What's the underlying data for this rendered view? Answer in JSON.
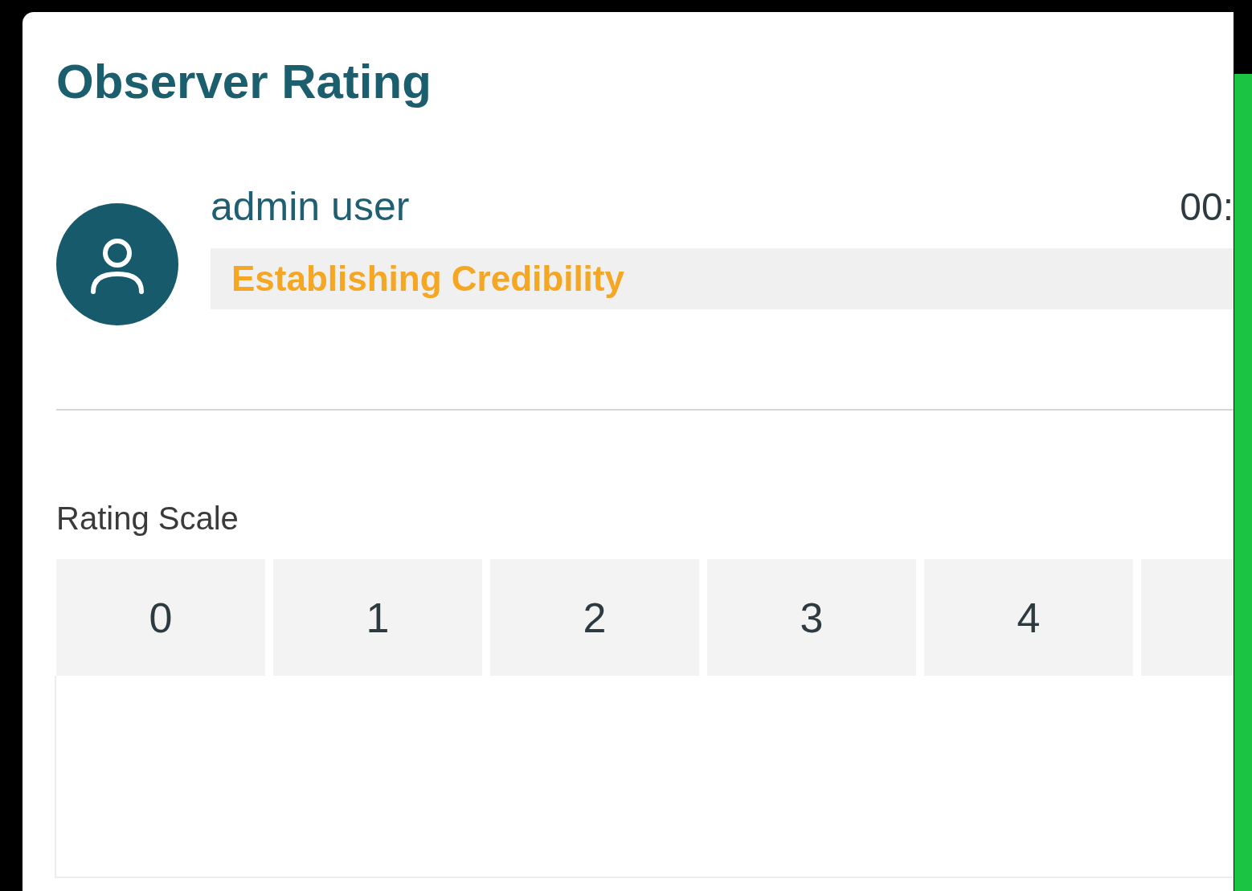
{
  "title": "Observer Rating",
  "observer": {
    "name": "admin user",
    "time": "00:",
    "topic": "Establishing Credibility"
  },
  "rating_scale": {
    "label": "Rating Scale",
    "options": [
      {
        "label": "0"
      },
      {
        "label": "1"
      },
      {
        "label": "2"
      },
      {
        "label": "3"
      },
      {
        "label": "4"
      }
    ]
  }
}
